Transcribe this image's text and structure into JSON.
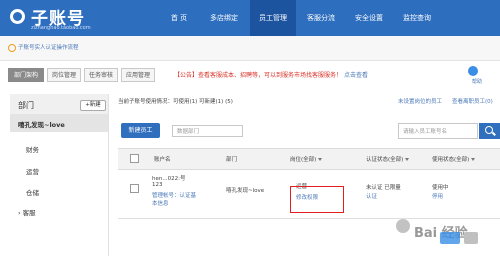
{
  "brand": {
    "title": "子账号",
    "subtitle": "zizhanghao.taobao.com"
  },
  "nav": [
    {
      "label": "首 页"
    },
    {
      "label": "多店绑定"
    },
    {
      "label": "员工管理"
    },
    {
      "label": "客服分流"
    },
    {
      "label": "安全设置"
    },
    {
      "label": "监控查询"
    }
  ],
  "notice": {
    "text": "子账号实人认证操作流程"
  },
  "tabs": [
    {
      "label": "部门架构"
    },
    {
      "label": "岗位管理"
    },
    {
      "label": "任务审核"
    },
    {
      "label": "应用管理"
    }
  ],
  "announce": {
    "prefix": "【公告】查看客服成本、招聘等，可以到服务市场找客服服务！",
    "link": "点击查看"
  },
  "help": {
    "label": "帮助"
  },
  "sidebar": {
    "title": "部门",
    "new_button": "+新建",
    "items": [
      {
        "label": "嘻孔发现~love"
      },
      {
        "label": "财务"
      },
      {
        "label": "运营"
      },
      {
        "label": "仓储"
      },
      {
        "label": "客服"
      }
    ]
  },
  "stats": {
    "text": "当前子账号使用情况：可使用(1)  可新建(1)  (5)",
    "link1": "未设置岗位的员工",
    "link2": "查看离职员工(0)"
  },
  "toolbar": {
    "new_employee": "新建员工",
    "dept_select": "数据部门",
    "search_placeholder": "请输入员工账号名"
  },
  "table": {
    "headers": [
      "账户名",
      "部门",
      "岗位(全部)",
      "认证状态(全部)",
      "使用状态(全部)"
    ],
    "row": {
      "account_name": "hen...022:号",
      "account_line2": "123",
      "account_links": "管理帐号：认证基本信息",
      "department": "嘻孔发现~love",
      "position": "运营",
      "position_link": "修改权限",
      "auth_status": "未认证 已限量",
      "auth_link": "认证",
      "use_status": "使用中",
      "use_link": "停用"
    }
  },
  "watermark": {
    "text": "Bai 经验"
  }
}
